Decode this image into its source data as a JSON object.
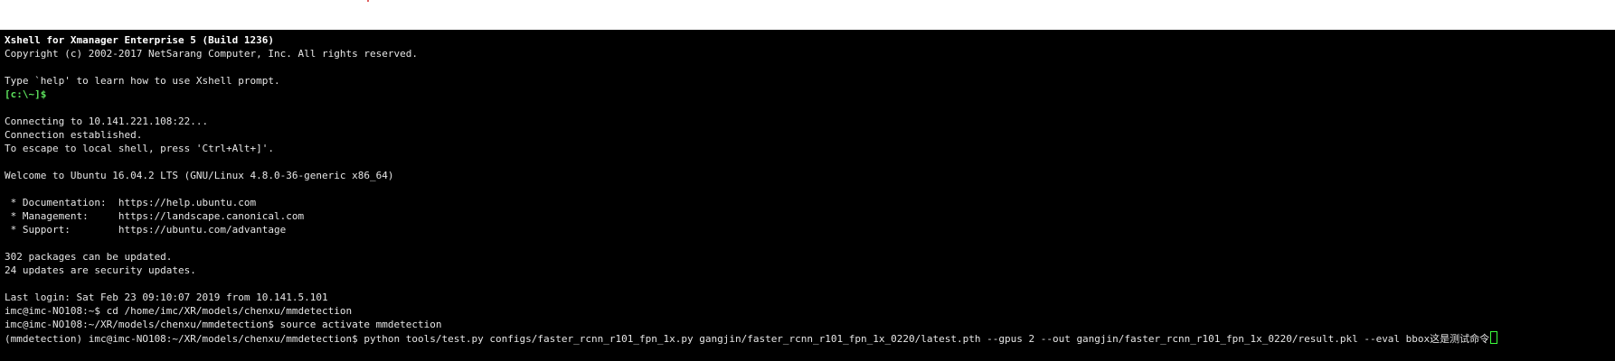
{
  "colors": {
    "background": "#000000",
    "foreground": "#e6e6e6",
    "prompt_green": "#5ce05c",
    "cursor": "#3cff3c"
  },
  "terminal": {
    "header_title": "Xshell for Xmanager Enterprise 5 (Build 1236)",
    "copyright": "Copyright (c) 2002-2017 NetSarang Computer, Inc. All rights reserved.",
    "help_hint": "Type `help' to learn how to use Xshell prompt.",
    "local_prompt": "[c:\\~]$",
    "connecting": "Connecting to 10.141.221.108:22...",
    "established": "Connection established.",
    "escape_hint": "To escape to local shell, press 'Ctrl+Alt+]'.",
    "welcome": "Welcome to Ubuntu 16.04.2 LTS (GNU/Linux 4.8.0-36-generic x86_64)",
    "doc_line": " * Documentation:  https://help.ubuntu.com",
    "mgmt_line": " * Management:     https://landscape.canonical.com",
    "support_line": " * Support:        https://ubuntu.com/advantage",
    "packages": "302 packages can be updated.",
    "security": "24 updates are security updates.",
    "last_login": "Last login: Sat Feb 23 09:10:07 2019 from 10.141.5.101",
    "cmd_cd": "imc@imc-NO108:~$ cd /home/imc/XR/models/chenxu/mmdetection",
    "cmd_source": "imc@imc-NO108:~/XR/models/chenxu/mmdetection$ source activate mmdetection",
    "cmd_python": "(mmdetection) imc@imc-NO108:~/XR/models/chenxu/mmdetection$ python tools/test.py configs/faster_rcnn_r101_fpn_1x.py gangjin/faster_rcnn_r101_fpn_1x_0220/latest.pth --gpus 2 --out gangjin/faster_rcnn_r101_fpn_1x_0220/result.pkl --eval bbox这是测试命令"
  }
}
